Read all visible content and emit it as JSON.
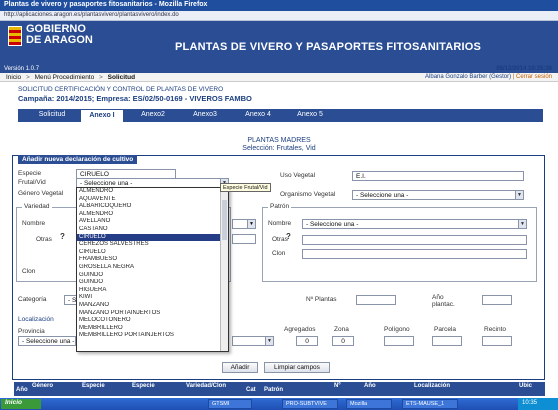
{
  "window": {
    "title": "Plantas de vivero y pasaportes fitosanitarios - Mozilla Firefox",
    "address": "http://aplicaciones.aragon.es/plantasvivero/plantasvivero/index.do"
  },
  "header": {
    "logo_line1": "GOBIERNO",
    "logo_line2": "DE ARAGON",
    "title": "PLANTAS DE VIVERO Y PASAPORTES FITOSANITARIOS",
    "version": "Versión 1.0.7",
    "date": "05/12/2014 10:35:36"
  },
  "breadcrumbs": [
    "Inicio",
    "Menú Procedimiento",
    "Solicitud"
  ],
  "user": {
    "name": "Albana Gonzalo Barber (Gestor)",
    "logout": "Cerrar sesión"
  },
  "subhead": "SOLICITUD CERTIFICACIÓN Y CONTROL DE PLANTAS DE VIVERO",
  "campaign": "Campaña: 2014/2015; Empresa: ES/02/50-0169 - VIVEROS FAMBO",
  "tabs": [
    "Solicitud",
    "Anexo I",
    "Anexo2",
    "Anexo3",
    "Anexo 4",
    "Anexo 5"
  ],
  "section": {
    "title": "PLANTAS MADRES",
    "subtitle": "Selección: Frutales, Vid"
  },
  "form": {
    "legend": "Añadir nueva declaración de cultivo",
    "especie_label": "Especie",
    "especie_value": "CIRUELO",
    "frutal_label": "Frutal/Vid",
    "frutal_value": "- Seleccione una -",
    "grupo_label": "Género Vegetal",
    "variedad_group": "Variedad",
    "variedad_label": "Nombre",
    "otras_label": "Otras",
    "clon_label": "Clon",
    "uso_label": "Uso Vegetal",
    "uso_value": "E.I.",
    "origen_label": "Organismo Vegetal",
    "origen_value": "- Seleccione una -",
    "patron_group": "Patrón",
    "patron_nombre_label": "Nombre",
    "patron_nombre_value": "- Seleccione una -",
    "patron_otras_label": "Otras",
    "patron_clon_label": "Clon",
    "categoria_label": "Categoría",
    "categoria_value": "- Sel",
    "nplantas_label": "Nº Plantas",
    "ano_label": "Año plantac.",
    "localizacion_label": "Localización",
    "provincia_label": "Provincia",
    "provincia_value": "- Seleccione una -",
    "agregados_label": "Agregados",
    "agregados_value": "0",
    "zona_label": "Zona",
    "zona_value": "0",
    "poligono_label": "Polígono",
    "parcela_label": "Parcela",
    "recinto_label": "Recinto",
    "tooltip": "Especie Frutal/Vid",
    "add_button": "Añadir",
    "clear_button": "Limpiar campos"
  },
  "dropdown_items": [
    "ALMENDRO",
    "AQUAVENTE",
    "ALBARICOQUERO",
    "ALMENDRO",
    "AVELLANO",
    "CASTAÑO",
    "CIRUELO",
    "CEREZOS SALVESTRES",
    "CIRUELO",
    "FRAMBUESO",
    "GROSELLA NEGRA",
    "GUINDO",
    "GUINDO",
    "HIGUERA",
    "KIWI",
    "MANZANO",
    "MANZANO PORTAINJERTOS",
    "MELOCOTONERO",
    "MEMBRILLERO",
    "MEMBRILLERO PORTAINJERTOS"
  ],
  "dropdown_selected_index": 6,
  "grid_headers": [
    "Año",
    "Género",
    "Especie",
    "Especie",
    "Variedad/Clon",
    "Cat",
    "Patrón",
    "Nº",
    "Año",
    "Localización",
    "Ubic"
  ],
  "taskbar": {
    "start": "Inicio",
    "items": [
      "GTSMI",
      "PRO-SUBTVIVE",
      "Mozilla",
      "ETS-MAUSE_1"
    ],
    "time": "10:35"
  }
}
